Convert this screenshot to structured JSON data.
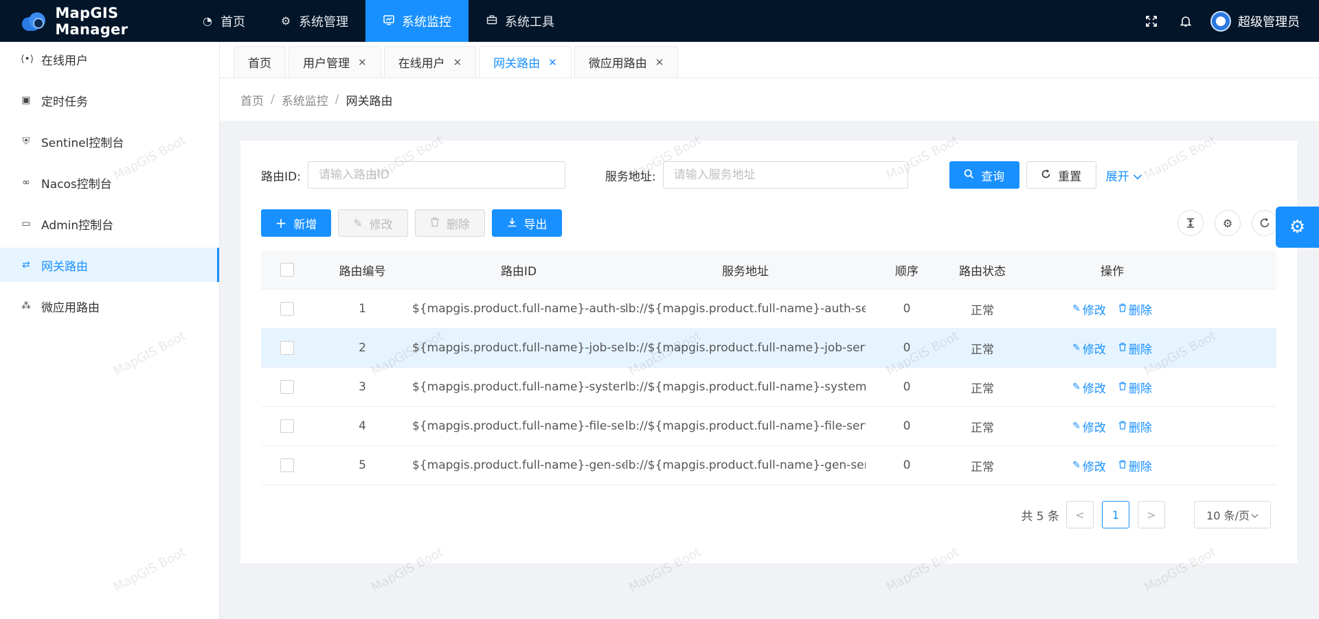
{
  "app": {
    "title": "MapGIS Manager"
  },
  "topnav": [
    {
      "label": "首页",
      "icon": "dashboard-icon"
    },
    {
      "label": "系统管理",
      "icon": "gear-icon"
    },
    {
      "label": "系统监控",
      "icon": "monitor-icon",
      "active": true
    },
    {
      "label": "系统工具",
      "icon": "toolbox-icon"
    }
  ],
  "user": {
    "name": "超级管理员"
  },
  "sidebar": {
    "items": [
      {
        "label": "在线用户",
        "icon": "online-icon"
      },
      {
        "label": "定时任务",
        "icon": "schedule-icon"
      },
      {
        "label": "Sentinel控制台",
        "icon": "shield-icon"
      },
      {
        "label": "Nacos控制台",
        "icon": "link-icon"
      },
      {
        "label": "Admin控制台",
        "icon": "screen-icon"
      },
      {
        "label": "网关路由",
        "icon": "route-icon",
        "active": true
      },
      {
        "label": "微应用路由",
        "icon": "network-icon"
      }
    ]
  },
  "tabs": [
    {
      "label": "首页",
      "closable": false
    },
    {
      "label": "用户管理",
      "closable": true
    },
    {
      "label": "在线用户",
      "closable": true
    },
    {
      "label": "网关路由",
      "closable": true,
      "active": true
    },
    {
      "label": "微应用路由",
      "closable": true
    }
  ],
  "breadcrumb": [
    "首页",
    "系统监控",
    "网关路由"
  ],
  "search": {
    "route_id_label": "路由ID:",
    "route_id_placeholder": "请输入路由ID",
    "route_id_value": "",
    "address_label": "服务地址:",
    "address_placeholder": "请输入服务地址",
    "address_value": "",
    "query_label": "查询",
    "reset_label": "重置",
    "expand_label": "展开"
  },
  "actions": {
    "add_label": "新增",
    "edit_label": "修改",
    "delete_label": "删除",
    "export_label": "导出"
  },
  "table": {
    "headers": [
      "路由编号",
      "路由ID",
      "服务地址",
      "顺序",
      "路由状态",
      "操作"
    ],
    "edit_label": "修改",
    "delete_label": "删除",
    "rows": [
      {
        "no": "1",
        "id": "${mapgis.product.full-name}-auth-server",
        "addr": "lb://${mapgis.product.full-name}-auth-server",
        "order": "0",
        "status": "正常"
      },
      {
        "no": "2",
        "id": "${mapgis.product.full-name}-job-server",
        "addr": "lb://${mapgis.product.full-name}-job-server",
        "order": "0",
        "status": "正常"
      },
      {
        "no": "3",
        "id": "${mapgis.product.full-name}-system-server",
        "addr": "lb://${mapgis.product.full-name}-system-server",
        "order": "0",
        "status": "正常"
      },
      {
        "no": "4",
        "id": "${mapgis.product.full-name}-file-server",
        "addr": "lb://${mapgis.product.full-name}-file-server",
        "order": "0",
        "status": "正常"
      },
      {
        "no": "5",
        "id": "${mapgis.product.full-name}-gen-server",
        "addr": "lb://${mapgis.product.full-name}-gen-server",
        "order": "0",
        "status": "正常"
      }
    ]
  },
  "pagination": {
    "total_label": "共 5 条",
    "current_page": "1",
    "prev": "<",
    "next": ">",
    "page_size": "10 条/页"
  },
  "watermark": "MapGIS Boot",
  "colors": {
    "primary": "#1890ff",
    "topbar": "#031529",
    "highlight_row": "#e6f4ff"
  }
}
